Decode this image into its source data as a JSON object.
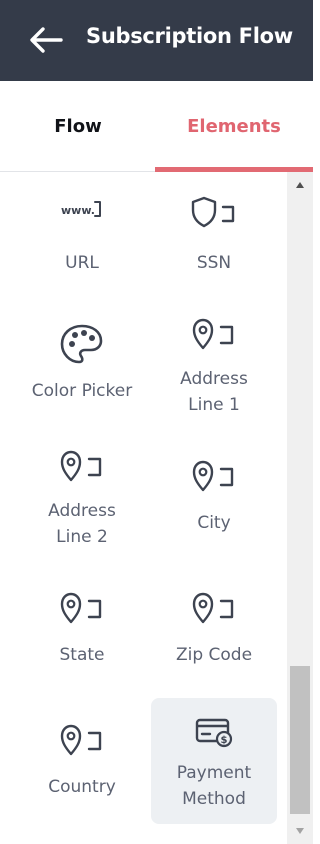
{
  "header": {
    "title": "Subscription Flow",
    "back_icon": "arrow-left-icon"
  },
  "tabs": [
    {
      "label": "Flow",
      "active": false
    },
    {
      "label": "Elements",
      "active": true
    }
  ],
  "colors": {
    "header_bg": "#343b49",
    "accent": "#e26a73",
    "selected_tile_bg": "#edf0f3"
  },
  "elements": [
    {
      "label": "URL",
      "icon": "www-icon"
    },
    {
      "label": "SSN",
      "icon": "shield-icon"
    },
    {
      "label": "Color Picker",
      "icon": "palette-icon"
    },
    {
      "label": "Address Line 1",
      "icon": "location-pin-icon"
    },
    {
      "label": "Address Line 2",
      "icon": "location-pin-icon"
    },
    {
      "label": "City",
      "icon": "location-pin-icon"
    },
    {
      "label": "State",
      "icon": "location-pin-icon"
    },
    {
      "label": "Zip Code",
      "icon": "location-pin-icon"
    },
    {
      "label": "Country",
      "icon": "location-pin-icon"
    },
    {
      "label": "Payment Method",
      "icon": "payment-card-icon",
      "selected": true
    }
  ]
}
